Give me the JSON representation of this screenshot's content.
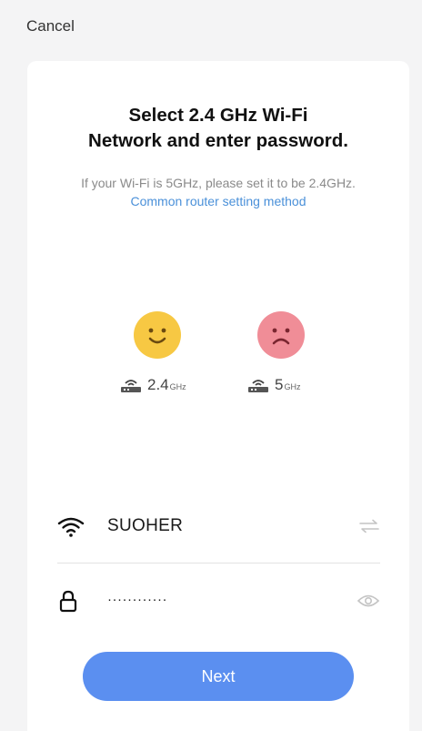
{
  "header": {
    "cancel_label": "Cancel"
  },
  "card": {
    "title_line1": "Select 2.4 GHz Wi-Fi",
    "title_line2": "Network and enter password.",
    "subtitle_text": "If your Wi-Fi is 5GHz, please set it to be 2.4GHz. ",
    "subtitle_link": "Common router setting method"
  },
  "bands": [
    {
      "number": "2.4",
      "unit": "GHz",
      "status": "supported",
      "face": "happy-face-icon",
      "color": "#f7c843"
    },
    {
      "number": "5",
      "unit": "GHz",
      "status": "unsupported",
      "face": "sad-face-icon",
      "color": "#f08d97"
    }
  ],
  "form": {
    "network_name": "SUOHER",
    "password_masked": "············",
    "next_label": "Next"
  },
  "colors": {
    "accent": "#5b8ff0",
    "link": "#4a90d9",
    "happy": "#f7c843",
    "sad": "#f08d97"
  }
}
